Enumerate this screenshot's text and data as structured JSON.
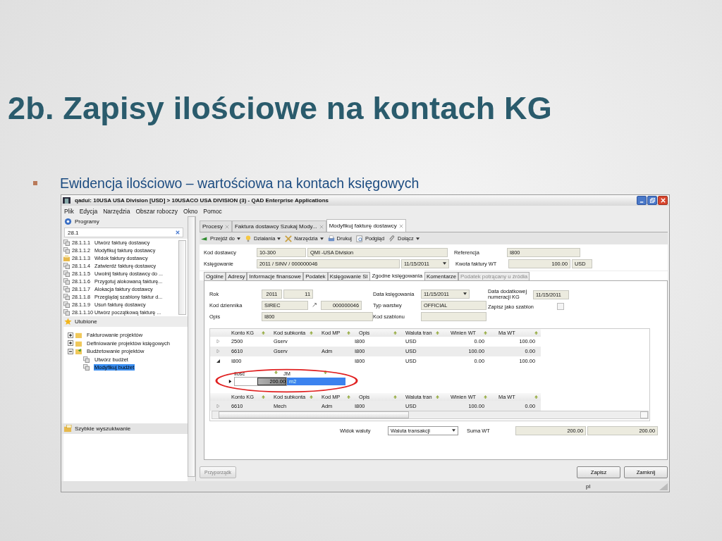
{
  "slide": {
    "title": "2b. Zapisy ilościowe na kontach KG",
    "bullet": "Ewidencja ilościowo – wartościowa na kontach księgowych"
  },
  "window": {
    "title": "qadui: 10USA USA Division [USD] > 10USACO USA DIVISION (3) - QAD Enterprise Applications"
  },
  "menu": [
    "Plik",
    "Edycja",
    "Narzędzia",
    "Obszar roboczy",
    "Okno",
    "Pomoc"
  ],
  "sidebar": {
    "programs_title": "Programy",
    "search": "28.1",
    "programs": [
      {
        "code": "28.1.1.1",
        "label": "Utwórz fakturę dostawcy",
        "kind": "program"
      },
      {
        "code": "28.1.1.2",
        "label": "Modyfikuj fakturę dostawcy",
        "kind": "program"
      },
      {
        "code": "28.1.1.3",
        "label": "Widok faktury dostawcy",
        "kind": "view"
      },
      {
        "code": "28.1.1.4",
        "label": "Zatwierdź fakturę dostawcy",
        "kind": "program"
      },
      {
        "code": "28.1.1.5",
        "label": "Uwolnij fakturę dostawcy do ...",
        "kind": "program"
      },
      {
        "code": "28.1.1.6",
        "label": "Przygotuj alokowaną fakturę...",
        "kind": "program"
      },
      {
        "code": "28.1.1.7",
        "label": "Alokacja faktury dostawcy",
        "kind": "program"
      },
      {
        "code": "28.1.1.8",
        "label": "Przeglądaj szablony faktur d...",
        "kind": "program"
      },
      {
        "code": "28.1.1.9",
        "label": "Usuń fakturę dostawcy",
        "kind": "program"
      },
      {
        "code": "28.1.1.10",
        "label": "Utwórz początkową fakturę ...",
        "kind": "program"
      }
    ],
    "favorites_title": "Ulubione",
    "favorites": [
      {
        "label": "Fakturowanie projektów",
        "expanded": false,
        "selected": false
      },
      {
        "label": "Definiowanie projektów księgowych",
        "expanded": false,
        "selected": false
      },
      {
        "label": "Budżetowanie projektów",
        "expanded": true,
        "selected": false,
        "children": [
          {
            "label": "Utwórz budżet",
            "selected": false
          },
          {
            "label": "Modyfikuj budżet",
            "selected": true
          }
        ]
      }
    ],
    "quick_search": "Szybkie wyszukiwanie"
  },
  "tabs": [
    {
      "label": "Procesy",
      "selected": false
    },
    {
      "label": "Faktura dostawcy Szukaj Mody...",
      "selected": false
    },
    {
      "label": "Modyfikuj fakturę dostawcy",
      "selected": true
    }
  ],
  "toolbar": [
    {
      "label": "Przejdź do",
      "kind": "go",
      "dropdown": true
    },
    {
      "label": "Działania",
      "kind": "bulb",
      "dropdown": true
    },
    {
      "label": "Narzędzia",
      "kind": "tools",
      "dropdown": true
    },
    {
      "label": "Drukuj",
      "kind": "print",
      "dropdown": false
    },
    {
      "label": "Podgląd",
      "kind": "preview",
      "dropdown": false
    },
    {
      "label": "Dołącz",
      "kind": "clip",
      "dropdown": true
    }
  ],
  "header": {
    "supplier_label": "Kod dostawcy",
    "supplier_code": "10-300",
    "supplier_name": "QMI -USA Division",
    "reference_label": "Referencja",
    "reference": "I800",
    "posting_label": "Księgowanie",
    "posting": "2011 / SINV / 000000046",
    "posting_date": "11/15/2011",
    "amount_label": "Kwota faktury WT",
    "amount": "100.00",
    "currency": "USD"
  },
  "form_tabs": [
    {
      "label": "Ogólne",
      "selected": false,
      "disabled": false
    },
    {
      "label": "Adresy",
      "selected": false,
      "disabled": false
    },
    {
      "label": "Informacje finansowe",
      "selected": false,
      "disabled": false
    },
    {
      "label": "Podatek",
      "selected": false,
      "disabled": false
    },
    {
      "label": "Księgowanie SI",
      "selected": false,
      "disabled": false
    },
    {
      "label": "Zgodne księgowania",
      "selected": true,
      "disabled": false
    },
    {
      "label": "Komentarze",
      "selected": false,
      "disabled": false
    },
    {
      "label": "Podatek potrącany u źródła",
      "selected": false,
      "disabled": true
    }
  ],
  "form": {
    "year_label": "Rok",
    "year": "2011",
    "period": "11",
    "journal_label": "Kod dziennika",
    "journal": "SIREC",
    "journal_no": "000000046",
    "desc_label": "Opis",
    "desc": "I800",
    "date_label": "Data księgowania",
    "date": "11/15/2011",
    "layer_label": "Typ warstwy",
    "layer": "OFFICIAL",
    "template_label": "Kod szablonu",
    "extra_date_label": "Data dodatkowej numeracji KG",
    "extra_date": "11/15/2011",
    "save_template_label": "Zapisz jako szablon",
    "save_template": false
  },
  "grid": {
    "columns": [
      "Konto KG",
      "Kod subkonta",
      "Kod MP",
      "Opis",
      "Waluta tran",
      "Winien WT",
      "Ma WT"
    ],
    "rows": [
      {
        "expanded": false,
        "cells": [
          "2500",
          "Gserv",
          "",
          "I800",
          "USD",
          "0.00",
          "100.00"
        ]
      },
      {
        "expanded": false,
        "cells": [
          "6610",
          "Gserv",
          "Adm",
          "I800",
          "USD",
          "100.00",
          "0.00"
        ]
      },
      {
        "expanded": true,
        "cells": [
          "I800",
          "",
          "",
          "I800",
          "USD",
          "0.00",
          "100.00"
        ]
      }
    ],
    "detail": {
      "columns": [
        "Ilość",
        "JM"
      ],
      "rows": [
        {
          "cells": [
            "200.00",
            "m2"
          ],
          "selected": true
        }
      ]
    },
    "lower_columns": [
      "Konto KG",
      "Kod subkonta",
      "Kod MP",
      "Opis",
      "Waluta tran",
      "Winien WT",
      "Ma WT"
    ],
    "lower_rows": [
      {
        "expanded": false,
        "cells": [
          "6610",
          "Mech",
          "Adm",
          "I800",
          "USD",
          "100.00",
          "0.00"
        ]
      }
    ]
  },
  "footer": {
    "currency_view_label": "Widok waluty",
    "currency_view": "Waluta transakcji",
    "sum_label": "Suma WT",
    "sum_debit": "200.00",
    "sum_credit": "200.00"
  },
  "buttons": [
    {
      "label": "Przyporządk",
      "disabled": true
    },
    {
      "label": "Zapisz",
      "disabled": false
    },
    {
      "label": "Zamknij",
      "disabled": false
    }
  ],
  "status": "pl"
}
